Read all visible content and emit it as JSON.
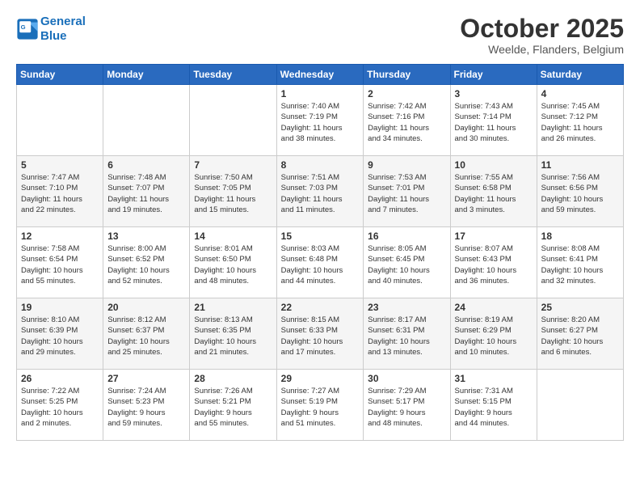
{
  "header": {
    "logo_line1": "General",
    "logo_line2": "Blue",
    "month": "October 2025",
    "location": "Weelde, Flanders, Belgium"
  },
  "days_of_week": [
    "Sunday",
    "Monday",
    "Tuesday",
    "Wednesday",
    "Thursday",
    "Friday",
    "Saturday"
  ],
  "weeks": [
    [
      {
        "day": "",
        "info": ""
      },
      {
        "day": "",
        "info": ""
      },
      {
        "day": "",
        "info": ""
      },
      {
        "day": "1",
        "info": "Sunrise: 7:40 AM\nSunset: 7:19 PM\nDaylight: 11 hours\nand 38 minutes."
      },
      {
        "day": "2",
        "info": "Sunrise: 7:42 AM\nSunset: 7:16 PM\nDaylight: 11 hours\nand 34 minutes."
      },
      {
        "day": "3",
        "info": "Sunrise: 7:43 AM\nSunset: 7:14 PM\nDaylight: 11 hours\nand 30 minutes."
      },
      {
        "day": "4",
        "info": "Sunrise: 7:45 AM\nSunset: 7:12 PM\nDaylight: 11 hours\nand 26 minutes."
      }
    ],
    [
      {
        "day": "5",
        "info": "Sunrise: 7:47 AM\nSunset: 7:10 PM\nDaylight: 11 hours\nand 22 minutes."
      },
      {
        "day": "6",
        "info": "Sunrise: 7:48 AM\nSunset: 7:07 PM\nDaylight: 11 hours\nand 19 minutes."
      },
      {
        "day": "7",
        "info": "Sunrise: 7:50 AM\nSunset: 7:05 PM\nDaylight: 11 hours\nand 15 minutes."
      },
      {
        "day": "8",
        "info": "Sunrise: 7:51 AM\nSunset: 7:03 PM\nDaylight: 11 hours\nand 11 minutes."
      },
      {
        "day": "9",
        "info": "Sunrise: 7:53 AM\nSunset: 7:01 PM\nDaylight: 11 hours\nand 7 minutes."
      },
      {
        "day": "10",
        "info": "Sunrise: 7:55 AM\nSunset: 6:58 PM\nDaylight: 11 hours\nand 3 minutes."
      },
      {
        "day": "11",
        "info": "Sunrise: 7:56 AM\nSunset: 6:56 PM\nDaylight: 10 hours\nand 59 minutes."
      }
    ],
    [
      {
        "day": "12",
        "info": "Sunrise: 7:58 AM\nSunset: 6:54 PM\nDaylight: 10 hours\nand 55 minutes."
      },
      {
        "day": "13",
        "info": "Sunrise: 8:00 AM\nSunset: 6:52 PM\nDaylight: 10 hours\nand 52 minutes."
      },
      {
        "day": "14",
        "info": "Sunrise: 8:01 AM\nSunset: 6:50 PM\nDaylight: 10 hours\nand 48 minutes."
      },
      {
        "day": "15",
        "info": "Sunrise: 8:03 AM\nSunset: 6:48 PM\nDaylight: 10 hours\nand 44 minutes."
      },
      {
        "day": "16",
        "info": "Sunrise: 8:05 AM\nSunset: 6:45 PM\nDaylight: 10 hours\nand 40 minutes."
      },
      {
        "day": "17",
        "info": "Sunrise: 8:07 AM\nSunset: 6:43 PM\nDaylight: 10 hours\nand 36 minutes."
      },
      {
        "day": "18",
        "info": "Sunrise: 8:08 AM\nSunset: 6:41 PM\nDaylight: 10 hours\nand 32 minutes."
      }
    ],
    [
      {
        "day": "19",
        "info": "Sunrise: 8:10 AM\nSunset: 6:39 PM\nDaylight: 10 hours\nand 29 minutes."
      },
      {
        "day": "20",
        "info": "Sunrise: 8:12 AM\nSunset: 6:37 PM\nDaylight: 10 hours\nand 25 minutes."
      },
      {
        "day": "21",
        "info": "Sunrise: 8:13 AM\nSunset: 6:35 PM\nDaylight: 10 hours\nand 21 minutes."
      },
      {
        "day": "22",
        "info": "Sunrise: 8:15 AM\nSunset: 6:33 PM\nDaylight: 10 hours\nand 17 minutes."
      },
      {
        "day": "23",
        "info": "Sunrise: 8:17 AM\nSunset: 6:31 PM\nDaylight: 10 hours\nand 13 minutes."
      },
      {
        "day": "24",
        "info": "Sunrise: 8:19 AM\nSunset: 6:29 PM\nDaylight: 10 hours\nand 10 minutes."
      },
      {
        "day": "25",
        "info": "Sunrise: 8:20 AM\nSunset: 6:27 PM\nDaylight: 10 hours\nand 6 minutes."
      }
    ],
    [
      {
        "day": "26",
        "info": "Sunrise: 7:22 AM\nSunset: 5:25 PM\nDaylight: 10 hours\nand 2 minutes."
      },
      {
        "day": "27",
        "info": "Sunrise: 7:24 AM\nSunset: 5:23 PM\nDaylight: 9 hours\nand 59 minutes."
      },
      {
        "day": "28",
        "info": "Sunrise: 7:26 AM\nSunset: 5:21 PM\nDaylight: 9 hours\nand 55 minutes."
      },
      {
        "day": "29",
        "info": "Sunrise: 7:27 AM\nSunset: 5:19 PM\nDaylight: 9 hours\nand 51 minutes."
      },
      {
        "day": "30",
        "info": "Sunrise: 7:29 AM\nSunset: 5:17 PM\nDaylight: 9 hours\nand 48 minutes."
      },
      {
        "day": "31",
        "info": "Sunrise: 7:31 AM\nSunset: 5:15 PM\nDaylight: 9 hours\nand 44 minutes."
      },
      {
        "day": "",
        "info": ""
      }
    ]
  ]
}
